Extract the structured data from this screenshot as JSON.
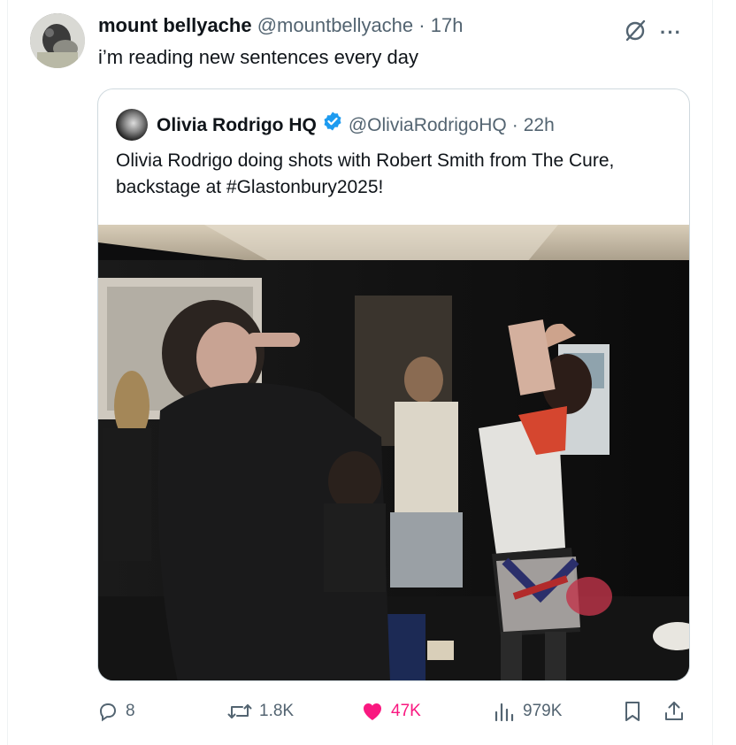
{
  "tweet": {
    "author_name": "mount bellyache",
    "handle": "@mountbellyache",
    "separator": "·",
    "time": "17h",
    "text": "i’m reading new sentences every day",
    "more_label": "···"
  },
  "quote": {
    "author_name": "Olivia Rodrigo HQ",
    "verified": true,
    "handle": "@OliviaRodrigoHQ",
    "separator": "·",
    "time": "22h",
    "text": "Olivia Rodrigo doing shots with Robert Smith from The Cure, backstage at #Glastonbury2025!"
  },
  "actions": {
    "replies": "8",
    "reposts": "1.8K",
    "likes": "47K",
    "views": "979K"
  },
  "colors": {
    "like": "#f91880",
    "verified": "#1d9bf0",
    "muted": "#536471"
  }
}
